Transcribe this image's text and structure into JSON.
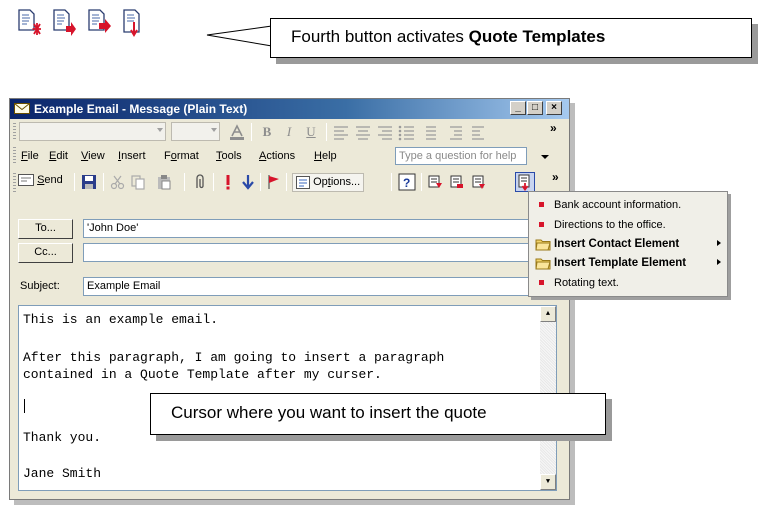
{
  "callouts": {
    "top_prefix": "Fourth button activates ",
    "top_bold": "Quote Templates",
    "bottom": "Cursor where you want to insert the quote"
  },
  "top_icons": [
    "new-quote-icon",
    "quote-paste-icon",
    "quote-forward-icon",
    "quote-templates-icon"
  ],
  "window": {
    "title": "Example Email - Message (Plain Text)",
    "controls": [
      "_",
      "□",
      "×"
    ]
  },
  "format_bar": {
    "bold": "B",
    "italic": "I",
    "underline": "U"
  },
  "menu": {
    "items": [
      {
        "label_pre": "",
        "accel": "F",
        "label_post": "ile"
      },
      {
        "label_pre": "",
        "accel": "E",
        "label_post": "dit"
      },
      {
        "label_pre": "",
        "accel": "V",
        "label_post": "iew"
      },
      {
        "label_pre": "",
        "accel": "I",
        "label_post": "nsert"
      },
      {
        "label_pre": "F",
        "accel": "o",
        "label_post": "rmat"
      },
      {
        "label_pre": "",
        "accel": "T",
        "label_post": "ools"
      },
      {
        "label_pre": "",
        "accel": "A",
        "label_post": "ctions"
      },
      {
        "label_pre": "",
        "accel": "H",
        "label_post": "elp"
      }
    ],
    "help_placeholder": "Type a question for help"
  },
  "standard_bar": {
    "send_accel": "S",
    "send_rest": "end",
    "options_pre": "Op",
    "options_accel": "t",
    "options_post": "ions..."
  },
  "header": {
    "to_label": "To...",
    "to_value": "'John Doe'",
    "cc_label": "Cc...",
    "cc_value": "",
    "subject_label": "Subject:",
    "subject_value": "Example Email"
  },
  "body_lines": [
    "This is an example email.",
    "",
    "After this paragraph, I am going to insert a paragraph",
    "contained in a Quote Template after my curser.",
    "",
    "",
    "Thank you.",
    "",
    "Jane Smith"
  ],
  "popup_menu": {
    "items": [
      {
        "label": "Bank account information.",
        "kind": "item"
      },
      {
        "label": "Directions to the office.",
        "kind": "item"
      },
      {
        "label": "Insert Contact Element",
        "kind": "submenu"
      },
      {
        "label": "Insert Template Element",
        "kind": "submenu"
      },
      {
        "label": "Rotating text.",
        "kind": "item"
      }
    ]
  },
  "colors": {
    "accent_red": "#d7142b",
    "title_bar": "#0a246a",
    "chrome": "#ece9d8"
  }
}
